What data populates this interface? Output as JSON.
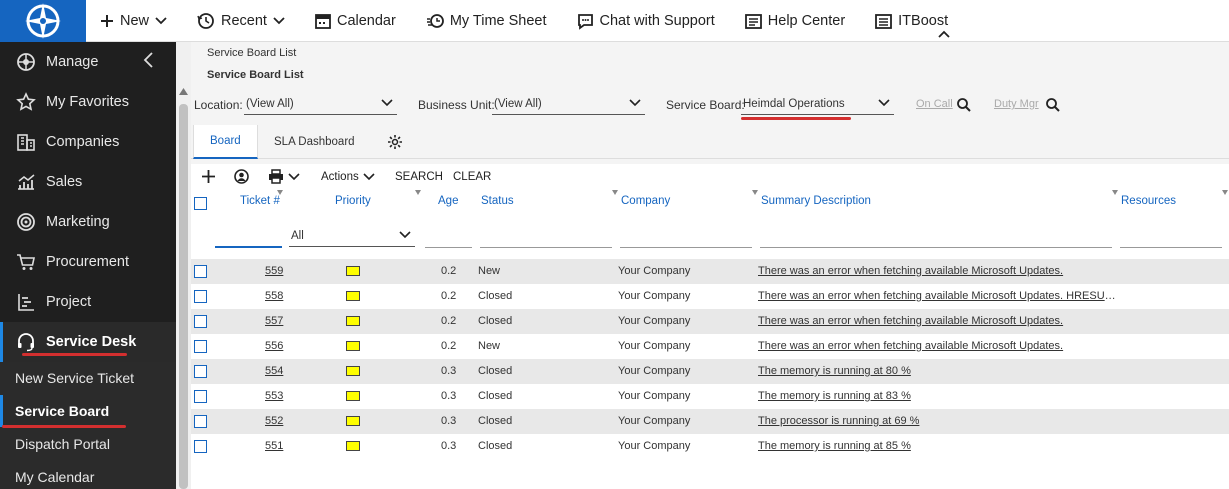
{
  "topnav": {
    "items": [
      {
        "label": "New",
        "icon": "plus-icon"
      },
      {
        "label": "Recent",
        "icon": "history-icon"
      },
      {
        "label": "Calendar",
        "icon": "calendar-icon"
      },
      {
        "label": "My Time Sheet",
        "icon": "timesheet-icon"
      },
      {
        "label": "Chat with Support",
        "icon": "chat-icon"
      },
      {
        "label": "Help Center",
        "icon": "help-center-icon"
      },
      {
        "label": "ITBoost",
        "icon": "itboost-icon"
      }
    ]
  },
  "sidebar": {
    "items": [
      {
        "label": "Manage",
        "icon": "manage-icon"
      },
      {
        "label": "My Favorites",
        "icon": "star-icon"
      },
      {
        "label": "Companies",
        "icon": "building-icon"
      },
      {
        "label": "Sales",
        "icon": "sales-chart-icon"
      },
      {
        "label": "Marketing",
        "icon": "target-icon"
      },
      {
        "label": "Procurement",
        "icon": "cart-icon"
      },
      {
        "label": "Project",
        "icon": "project-icon"
      },
      {
        "label": "Service Desk",
        "icon": "headset-icon"
      }
    ],
    "sub_items": [
      {
        "label": "New Service Ticket"
      },
      {
        "label": "Service Board"
      },
      {
        "label": "Dispatch Portal"
      },
      {
        "label": "My Calendar"
      }
    ]
  },
  "breadcrumb": {
    "parent": "Service Board List",
    "current": "Service Board List"
  },
  "filters": {
    "location_label": "Location:",
    "location_value": "(View All)",
    "business_unit_label": "Business Unit:",
    "business_unit_value": "(View All)",
    "service_board_label": "Service Board:",
    "service_board_value": "Heimdal Operations",
    "on_call": "On Call",
    "duty_mgr": "Duty Mgr"
  },
  "tabs": [
    {
      "label": "Board"
    },
    {
      "label": "SLA Dashboard"
    }
  ],
  "toolbar": {
    "actions": "Actions",
    "search": "SEARCH",
    "clear": "CLEAR"
  },
  "grid": {
    "columns": {
      "ticket": "Ticket #",
      "priority": "Priority",
      "age": "Age",
      "status": "Status",
      "company": "Company",
      "summary": "Summary Description",
      "resources": "Resources"
    },
    "priority_filter": "All",
    "priority_color": "#ffff00",
    "rows": [
      {
        "ticket": "559",
        "age": "0.2",
        "status": "New",
        "company": "Your Company",
        "summary": "There was an error when fetching available Microsoft Updates."
      },
      {
        "ticket": "558",
        "age": "0.2",
        "status": "Closed",
        "company": "Your Company",
        "summary": "There was an error when fetching available Microsoft Updates. HRESULT..."
      },
      {
        "ticket": "557",
        "age": "0.2",
        "status": "Closed",
        "company": "Your Company",
        "summary": "There was an error when fetching available Microsoft Updates."
      },
      {
        "ticket": "556",
        "age": "0.2",
        "status": "New",
        "company": "Your Company",
        "summary": "There was an error when fetching available Microsoft Updates."
      },
      {
        "ticket": "554",
        "age": "0.3",
        "status": "Closed",
        "company": "Your Company",
        "summary": "The memory is running at 80 %"
      },
      {
        "ticket": "553",
        "age": "0.3",
        "status": "Closed",
        "company": "Your Company",
        "summary": "The memory is running at 83 %"
      },
      {
        "ticket": "552",
        "age": "0.3",
        "status": "Closed",
        "company": "Your Company",
        "summary": "The processor is running at 69 %"
      },
      {
        "ticket": "551",
        "age": "0.3",
        "status": "Closed",
        "company": "Your Company",
        "summary": "The memory is running at 85 %"
      }
    ]
  },
  "colors": {
    "brand_blue": "#1565c0",
    "sidebar_bg": "#1f1f1f",
    "highlight_red": "#d32f2f"
  }
}
